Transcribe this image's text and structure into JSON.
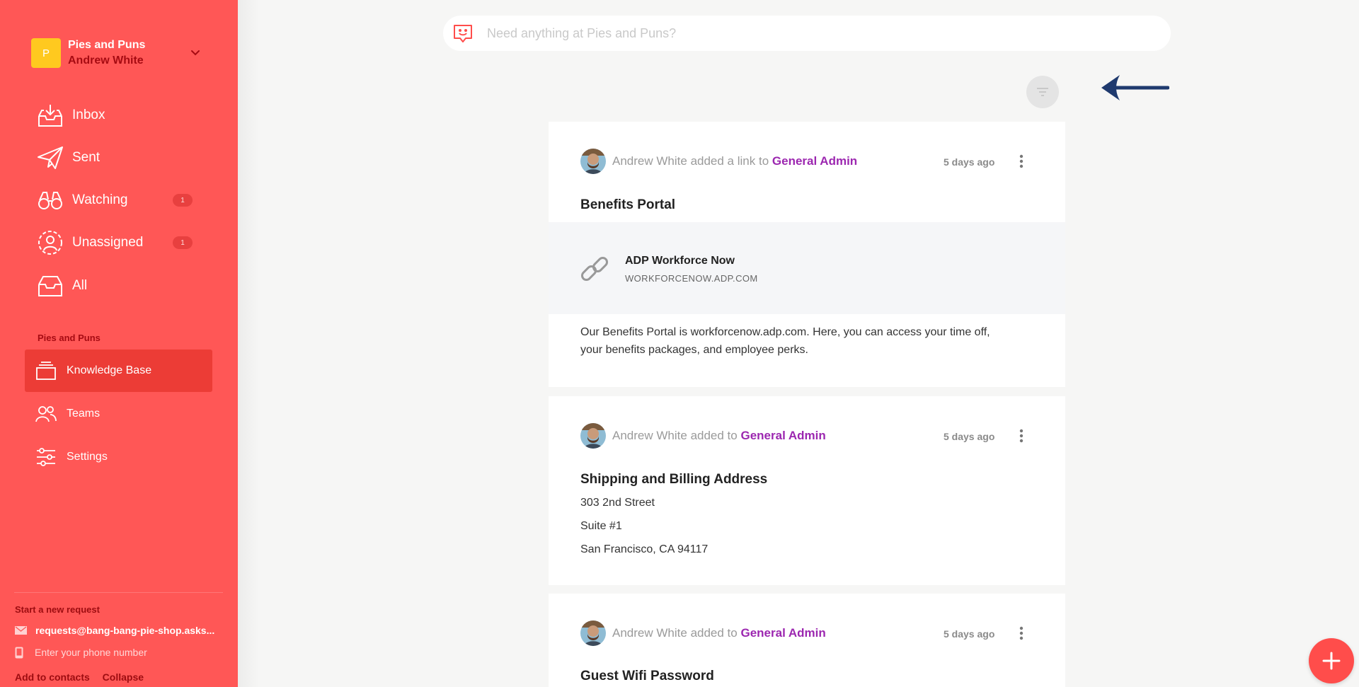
{
  "workspace": {
    "logo_letter": "P",
    "name": "Pies and Puns",
    "user": "Andrew White"
  },
  "nav": {
    "inbox": "Inbox",
    "sent": "Sent",
    "watching": "Watching",
    "watching_count": "1",
    "unassigned": "Unassigned",
    "unassigned_count": "1",
    "all": "All"
  },
  "section": {
    "title": "Pies and Puns",
    "knowledge_base": "Knowledge Base",
    "teams": "Teams",
    "settings": "Settings"
  },
  "footer": {
    "new_request": "Start a new request",
    "email": "requests@bang-bang-pie-shop.asks...",
    "phone_placeholder": "Enter your phone number",
    "add_contacts": "Add to contacts",
    "collapse": "Collapse"
  },
  "search": {
    "placeholder": "Need anything at Pies and Puns?"
  },
  "feed": [
    {
      "author": "Andrew White",
      "action": "added a link to",
      "group": "General Admin",
      "time": "5 days ago",
      "title": "Benefits Portal",
      "link_name": "ADP Workforce Now",
      "link_url": "WORKFORCENOW.ADP.COM",
      "body_line1": "Our Benefits Portal is workforcenow.adp.com. Here, you can access your time off,",
      "body_line2": "your benefits packages, and employee perks."
    },
    {
      "author": "Andrew White",
      "action": "added to",
      "group": "General Admin",
      "time": "5 days ago",
      "title": "Shipping and Billing Address",
      "lines": [
        "303 2nd Street",
        "Suite #1",
        "San Francisco, CA 94117"
      ]
    },
    {
      "author": "Andrew White",
      "action": "added to",
      "group": "General Admin",
      "time": "5 days ago",
      "title": "Guest Wifi Password"
    }
  ],
  "colors": {
    "sidebar": "#ff5756",
    "active_item": "#ec3c36",
    "accent_link": "#9c27b0",
    "fab": "#ff4d4b",
    "arrow": "#1f3a6e"
  }
}
